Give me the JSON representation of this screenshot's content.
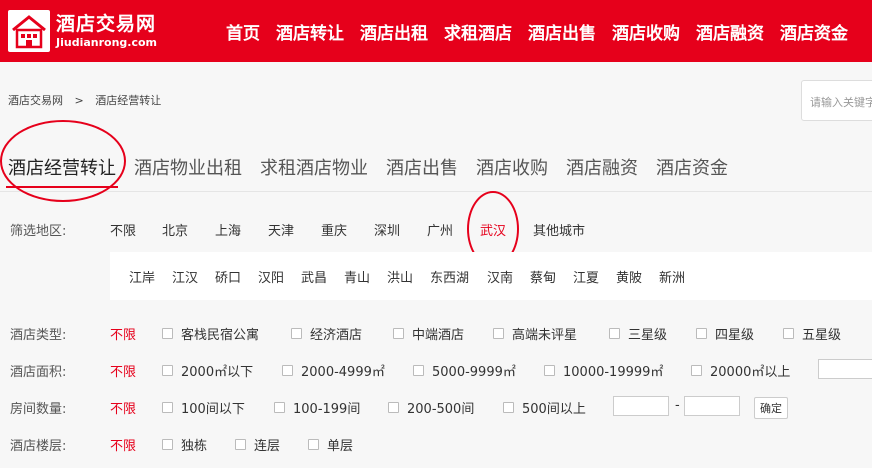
{
  "header": {
    "logo_cn": "酒店交易网",
    "logo_en": "Jiudianrong.com",
    "nav": [
      "首页",
      "酒店转让",
      "酒店出租",
      "求租酒店",
      "酒店出售",
      "酒店收购",
      "酒店融资",
      "酒店资金"
    ]
  },
  "breadcrumb": [
    "酒店交易网",
    ">",
    "酒店经营转让"
  ],
  "search": {
    "placeholder": "请输入关键字"
  },
  "tabs": [
    "酒店经营转让",
    "酒店物业出租",
    "求租酒店物业",
    "酒店出售",
    "酒店收购",
    "酒店融资",
    "酒店资金"
  ],
  "region": {
    "label": "筛选地区:",
    "cities": [
      "不限",
      "北京",
      "上海",
      "天津",
      "重庆",
      "深圳",
      "广州",
      "武汉",
      "其他城市"
    ],
    "selected_city": "武汉",
    "districts": [
      "江岸",
      "江汉",
      "硚口",
      "汉阳",
      "武昌",
      "青山",
      "洪山",
      "东西湖",
      "汉南",
      "蔡甸",
      "江夏",
      "黄陂",
      "新洲"
    ]
  },
  "filters": {
    "type": {
      "label": "酒店类型:",
      "unlimited": "不限",
      "options": [
        "客栈民宿公寓",
        "经济酒店",
        "中端酒店",
        "高端未评星",
        "三星级",
        "四星级",
        "五星级"
      ]
    },
    "area": {
      "label": "酒店面积:",
      "unlimited": "不限",
      "options": [
        "2000㎡以下",
        "2000-4999㎡",
        "5000-9999㎡",
        "10000-19999㎡",
        "20000㎡以上"
      ]
    },
    "rooms": {
      "label": "房间数量:",
      "unlimited": "不限",
      "options": [
        "100间以下",
        "100-199间",
        "200-500间",
        "500间以上"
      ],
      "dash": "-",
      "confirm": "确定"
    },
    "floors": {
      "label": "酒店楼层:",
      "unlimited": "不限",
      "options": [
        "独栋",
        "连层",
        "单层"
      ]
    }
  },
  "colors": {
    "brand_red": "#e6001b"
  }
}
